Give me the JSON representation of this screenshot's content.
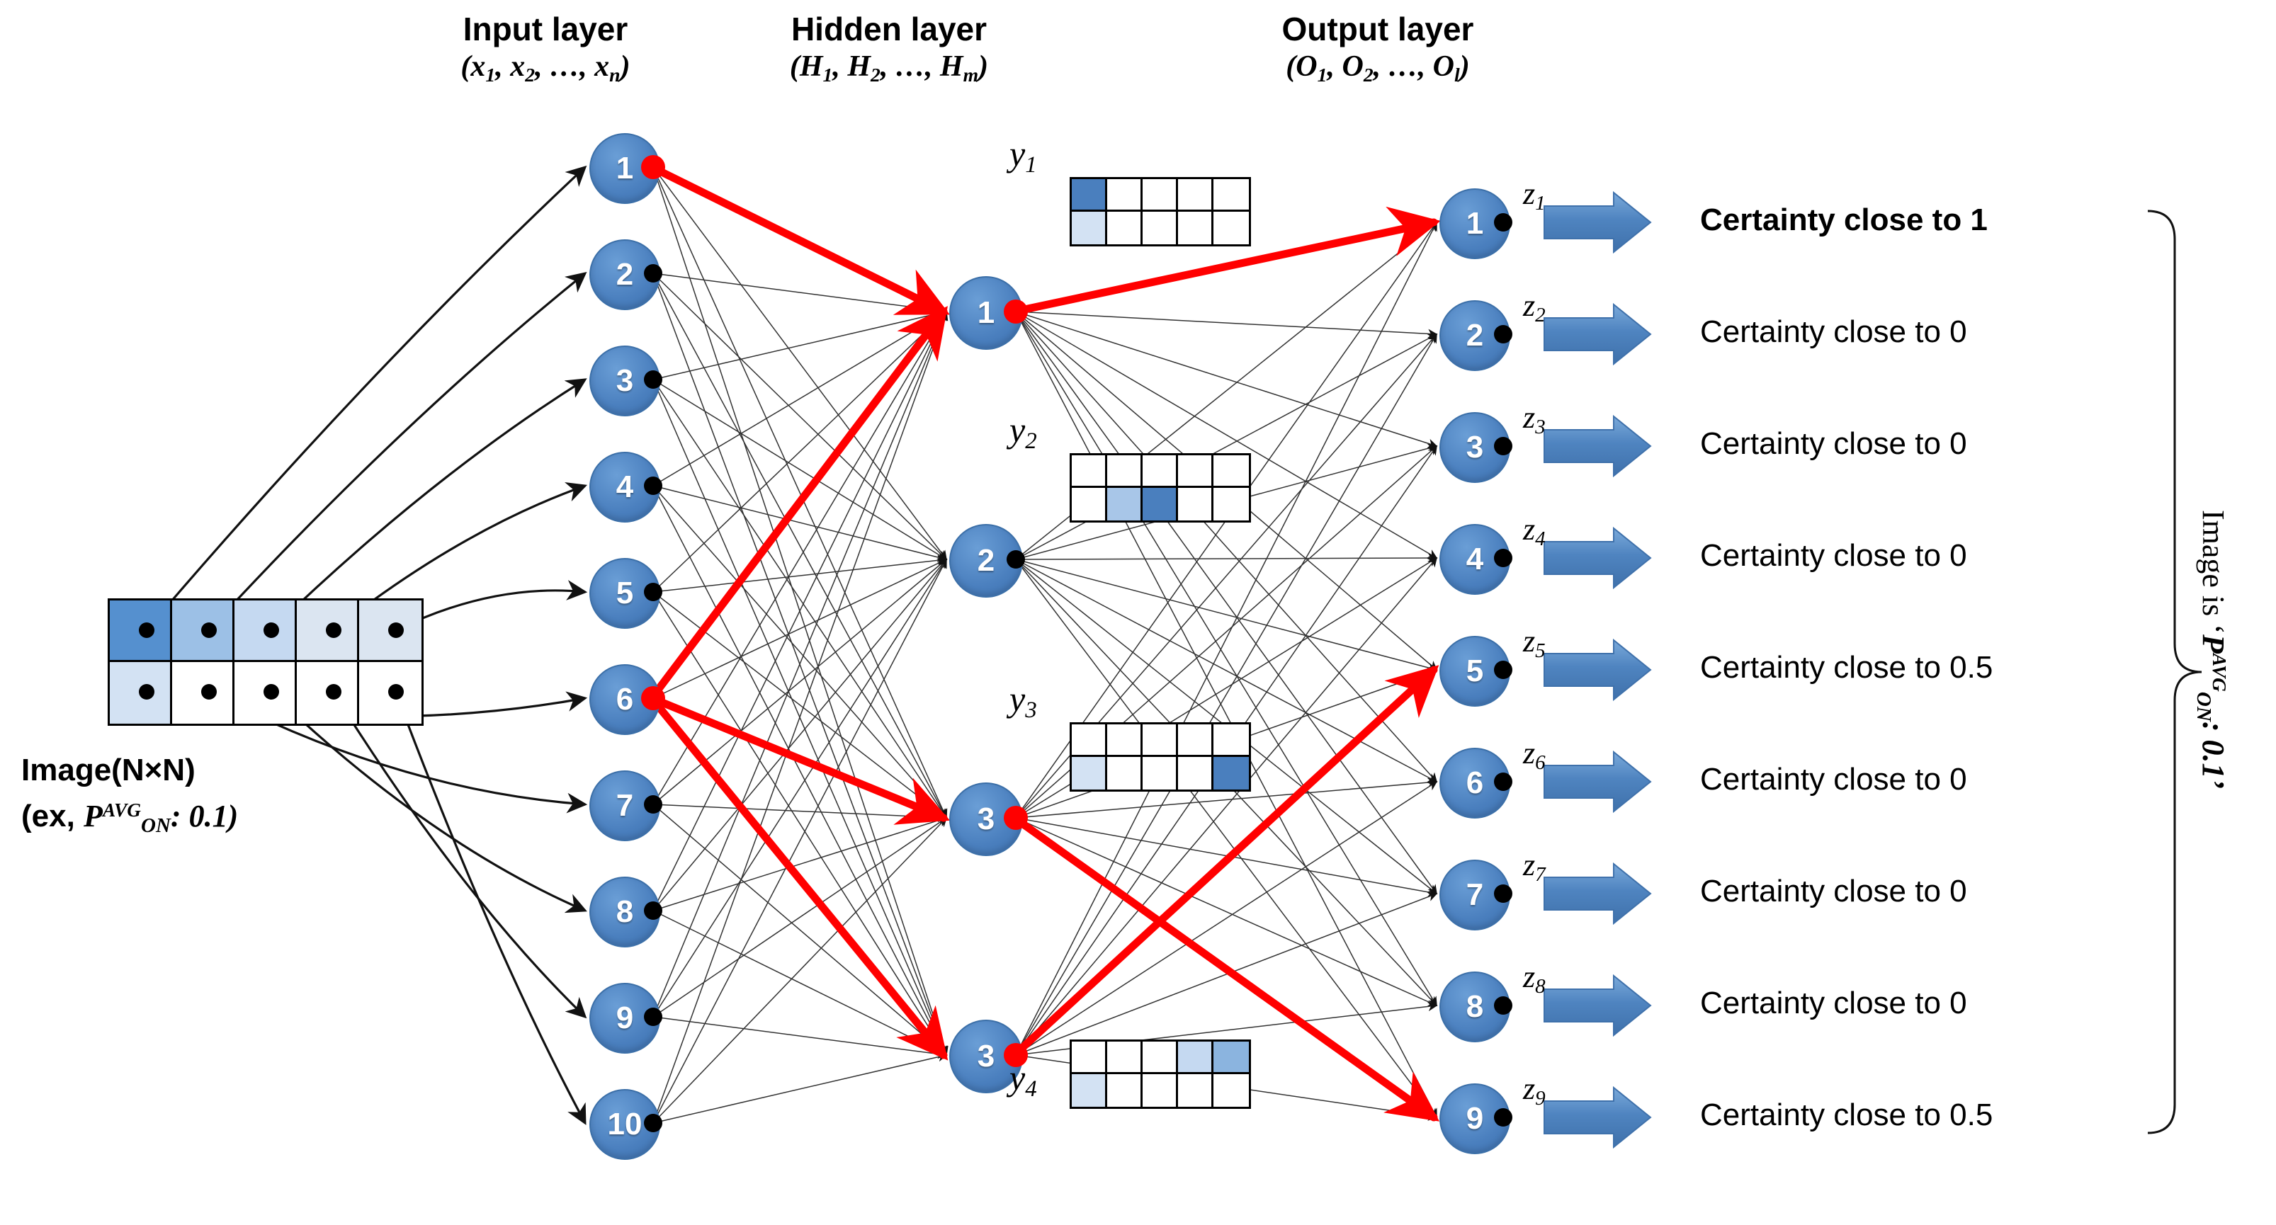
{
  "headers": {
    "input": {
      "title": "Input layer",
      "vars_prefix": "(x",
      "vars": "(x1, x2, …, xn)"
    },
    "hidden": {
      "title": "Hidden layer",
      "vars": "(H1, H2, …, Hm)"
    },
    "output": {
      "title": "Output layer",
      "vars": "(O1, O2, …, Ol)"
    }
  },
  "image_panel": {
    "label_line1": "Image(N×N)",
    "label_line2_prefix": "(ex, ",
    "label_line2_symbol": "P",
    "label_line2_sup": "AVG",
    "label_line2_sub": "ON",
    "label_line2_value": ": 0.1)",
    "grid": {
      "cols": 5,
      "rows": 2,
      "cells": [
        [
          "#5590cf",
          "#9cc0e6",
          "#c5d9f1",
          "#dbe5f1",
          "#dbe5f1"
        ],
        [
          "#d3e2f3",
          "#ffffff",
          "#ffffff",
          "#ffffff",
          "#ffffff"
        ]
      ]
    }
  },
  "input_layer": {
    "nodes": [
      "1",
      "2",
      "3",
      "4",
      "5",
      "6",
      "7",
      "8",
      "9",
      "10"
    ],
    "highlighted": [
      1,
      6
    ]
  },
  "hidden_layer": {
    "nodes": [
      "1",
      "2",
      "3",
      "3"
    ],
    "highlighted": [
      1,
      3,
      4
    ],
    "y_labels": [
      "y1",
      "y2",
      "y3",
      "y4"
    ],
    "grids": [
      {
        "label": "y1",
        "cols": 5,
        "rows": 2,
        "cells": [
          [
            "#4a7fbe",
            "#ffffff",
            "#ffffff",
            "#ffffff",
            "#ffffff"
          ],
          [
            "#d3e2f3",
            "#ffffff",
            "#ffffff",
            "#ffffff",
            "#ffffff"
          ]
        ]
      },
      {
        "label": "y2",
        "cols": 5,
        "rows": 2,
        "cells": [
          [
            "#ffffff",
            "#ffffff",
            "#ffffff",
            "#ffffff",
            "#ffffff"
          ],
          [
            "#ffffff",
            "#a8c6e8",
            "#4a7fbe",
            "#ffffff",
            "#ffffff"
          ]
        ]
      },
      {
        "label": "y3",
        "cols": 5,
        "rows": 2,
        "cells": [
          [
            "#ffffff",
            "#ffffff",
            "#ffffff",
            "#ffffff",
            "#ffffff"
          ],
          [
            "#d3e2f3",
            "#ffffff",
            "#ffffff",
            "#ffffff",
            "#4a7fbe"
          ]
        ]
      },
      {
        "label": "y4",
        "cols": 5,
        "rows": 2,
        "cells": [
          [
            "#ffffff",
            "#ffffff",
            "#ffffff",
            "#c5d9f1",
            "#8bb4df"
          ],
          [
            "#d3e2f3",
            "#ffffff",
            "#ffffff",
            "#ffffff",
            "#ffffff"
          ]
        ]
      }
    ]
  },
  "output_layer": {
    "nodes": [
      "1",
      "2",
      "3",
      "4",
      "5",
      "6",
      "7",
      "8",
      "9"
    ],
    "highlighted": [
      1,
      5,
      9
    ],
    "z_labels": [
      "z1",
      "z2",
      "z3",
      "z4",
      "z5",
      "z6",
      "z7",
      "z8",
      "z9"
    ],
    "certainty": [
      {
        "text": "Certainty close to 1",
        "bold": true
      },
      {
        "text": "Certainty close to 0",
        "bold": false
      },
      {
        "text": "Certainty close to 0",
        "bold": false
      },
      {
        "text": "Certainty close to 0",
        "bold": false
      },
      {
        "text": "Certainty close to 0.5",
        "bold": false
      },
      {
        "text": "Certainty close to 0",
        "bold": false
      },
      {
        "text": "Certainty close to 0",
        "bold": false
      },
      {
        "text": "Certainty close to 0",
        "bold": false
      },
      {
        "text": "Certainty close to 0.5",
        "bold": false
      }
    ]
  },
  "conclusion": {
    "prefix": "Image is ‘",
    "symbol": "P",
    "sup": "AVG",
    "sub": "ON",
    "value": ": 0.1’"
  },
  "colors": {
    "node_blue": "#4a7fbe",
    "highlight_red": "#ff0000",
    "arrow_blue": "#4a7fbe",
    "cell_dark": "#4a7fbe",
    "cell_light": "#d3e2f3"
  },
  "icons": {
    "block_arrow": "block-arrow-right-icon",
    "brace": "right-curly-brace-icon"
  }
}
